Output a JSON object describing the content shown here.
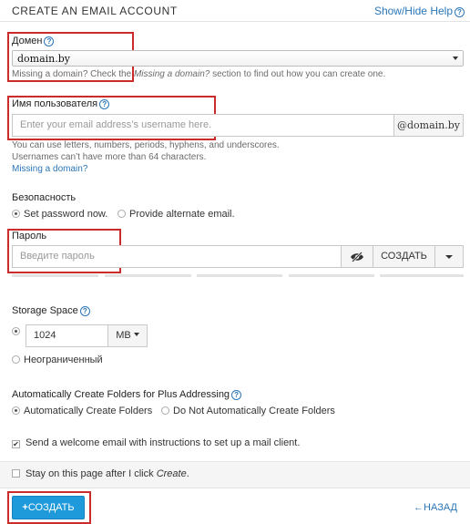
{
  "header": {
    "title": "CREATE AN EMAIL ACCOUNT",
    "help_link": "Show/Hide Help",
    "help_icon": "question-circle-icon"
  },
  "domain": {
    "label": "Домен",
    "value": "domain.by",
    "hint_prefix": "Missing a domain? Check the ",
    "hint_em": "Missing a domain?",
    "hint_suffix": " section to find out how you can create one."
  },
  "username": {
    "label": "Имя пользователя",
    "placeholder": "Enter your email address’s username here.",
    "suffix": "@domain.by",
    "hint1": "You can use letters, numbers, periods, hyphens, and underscores.",
    "hint2": "Usernames can’t have more than 64 characters.",
    "missing_link": "Missing a domain?"
  },
  "security": {
    "label": "Безопасность",
    "option_set": "Set password now.",
    "option_alternate": "Provide alternate email.",
    "selected": "set"
  },
  "password": {
    "label": "Пароль",
    "placeholder": "Введите пароль",
    "generate_label": "СОЗДАТЬ",
    "eye_icon": "eye-slash-icon",
    "dropdown_icon": "caret-down-icon"
  },
  "storage": {
    "label": "Storage Space",
    "value": "1024",
    "unit": "MB",
    "unlimited_label": "Неограниченный",
    "selected": "custom"
  },
  "plus_addressing": {
    "label": "Automatically Create Folders for Plus Addressing",
    "option_auto": "Automatically Create Folders",
    "option_none": "Do Not Automatically Create Folders",
    "selected": "auto"
  },
  "welcome": {
    "label": "Send a welcome email with instructions to set up a mail client.",
    "checked": true
  },
  "stay": {
    "label_prefix": "Stay on this page after I click ",
    "label_em": "Create",
    "label_suffix": ".",
    "checked": false
  },
  "actions": {
    "create_label": "СОЗДАТЬ",
    "create_icon": "plus-icon",
    "back_label": "НАЗАД",
    "back_icon": "arrow-left-icon"
  },
  "colors": {
    "accent": "#1e9adb",
    "link": "#2a76b8",
    "highlight_box": "#cc2b2b"
  }
}
